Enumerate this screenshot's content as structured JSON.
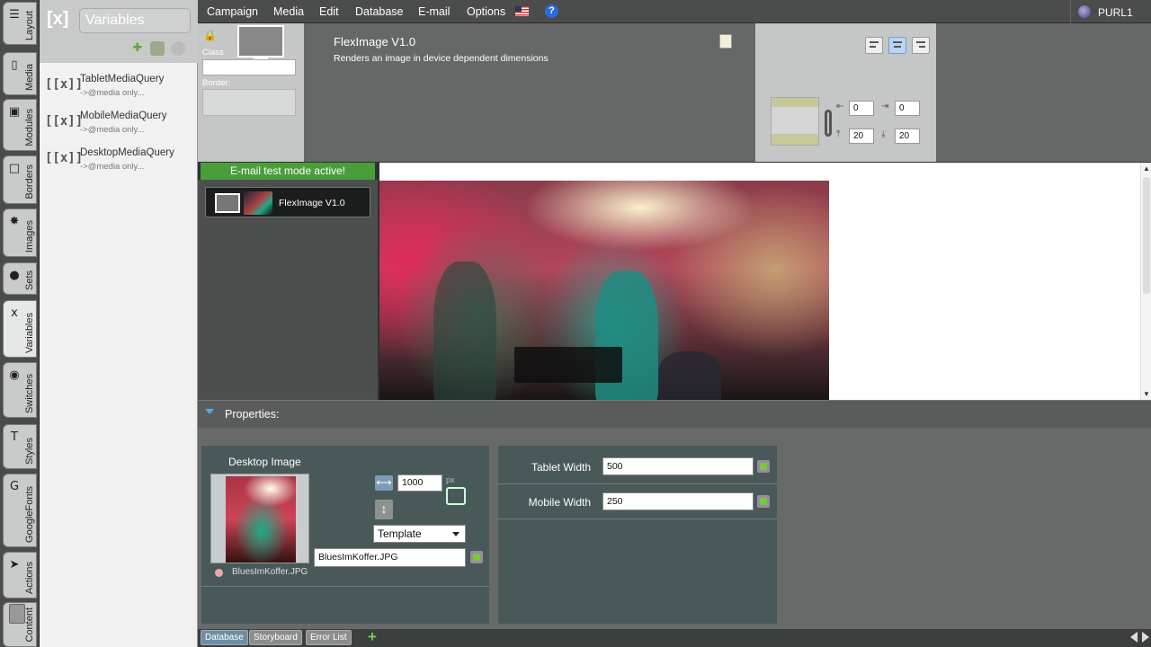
{
  "rail": {
    "tabs": [
      {
        "label": "Layout",
        "icon": "layout-icon"
      },
      {
        "label": "Media",
        "icon": "phone-icon"
      },
      {
        "label": "Modules",
        "icon": "modules-icon"
      },
      {
        "label": "Borders",
        "icon": "borders-icon"
      },
      {
        "label": "Images",
        "icon": "images-icon"
      },
      {
        "label": "Sets",
        "icon": "balloon-icon"
      },
      {
        "label": "Variables",
        "icon": "variables-icon"
      },
      {
        "label": "Switches",
        "icon": "eye-icon"
      },
      {
        "label": "Styles",
        "icon": "text-style-icon"
      },
      {
        "label": "GoogleFonts",
        "icon": "google-icon"
      },
      {
        "label": "Actions",
        "icon": "cursor-icon"
      },
      {
        "label": "Content",
        "icon": "trash-icon"
      }
    ]
  },
  "sidebar": {
    "logo": "[x]",
    "title": "Variables",
    "items": [
      {
        "icon": "[[x]]",
        "name": "TabletMediaQuery",
        "sub": "->@media only..."
      },
      {
        "icon": "[[x]]",
        "name": "MobileMediaQuery",
        "sub": "->@media only..."
      },
      {
        "icon": "[[x]]",
        "name": "DesktopMediaQuery",
        "sub": "->@media only..."
      }
    ]
  },
  "menu": {
    "items": [
      "Campaign",
      "Media",
      "Edit",
      "Database",
      "E-mail",
      "Options"
    ],
    "help": "?",
    "purl": "PURL1"
  },
  "module": {
    "class_label": "Class",
    "border_label": "Border:",
    "title": "FlexImage V1.0",
    "description": "Renders an image in device dependent dimensions",
    "padding": {
      "left": "0",
      "right": "0",
      "top": "20",
      "bottom": "20"
    }
  },
  "preview": {
    "test_mode": "E-mail test mode active!",
    "module_item": "FlexImage V1.0"
  },
  "properties": {
    "label": "Properties:",
    "desktop": {
      "title": "Desktop Image",
      "width": "1000",
      "unit": "px",
      "template": "Template",
      "file": "BluesImKoffer.JPG",
      "thumb_caption": "BluesImKoffer.JPG"
    },
    "tablet": {
      "label": "Tablet Width",
      "value": "500"
    },
    "mobile": {
      "label": "Mobile Width",
      "value": "250"
    }
  },
  "bottom_tabs": [
    "Database",
    "Storyboard",
    "Error List"
  ],
  "colors": {
    "test_mode_bg": "#4a9e3a",
    "accent": "#5fa3e0",
    "panel": "#49595a"
  }
}
